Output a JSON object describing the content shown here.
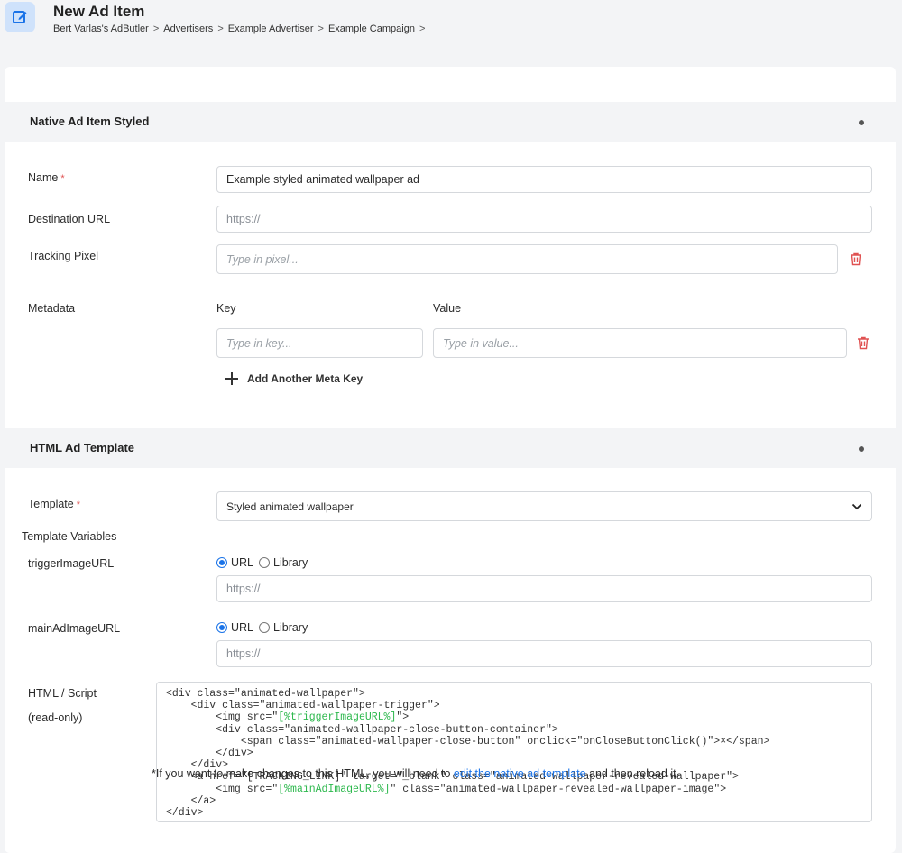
{
  "header": {
    "title": "New Ad Item",
    "breadcrumb": [
      "Bert Varlas's AdButler",
      "Advertisers",
      "Example Advertiser",
      "Example Campaign"
    ],
    "breadcrumb_sep": ">"
  },
  "native_section": {
    "title": "Native Ad Item Styled",
    "name_label": "Name",
    "required_mark": "*",
    "name_value": "Example styled animated wallpaper ad",
    "dest_label": "Destination URL",
    "dest_placeholder": "https://",
    "tracking_label": "Tracking Pixel",
    "tracking_placeholder": "Type in pixel...",
    "metadata_label": "Metadata",
    "key_header": "Key",
    "value_header": "Value",
    "key_placeholder": "Type in key...",
    "value_placeholder": "Type in value...",
    "add_meta_label": "Add Another Meta Key"
  },
  "html_section": {
    "title": "HTML Ad Template",
    "template_label": "Template",
    "template_value": "Styled animated wallpaper",
    "template_vars_label": "Template Variables",
    "var1_label": "triggerImageURL",
    "var2_label": "mainAdImageURL",
    "radio_url": "URL",
    "radio_library": "Library",
    "url_placeholder": "https://",
    "script_label": "HTML / Script",
    "readonly_label": "(read-only)",
    "code_lines": [
      {
        "text": "<div class=\"animated-wallpaper\">"
      },
      {
        "text": "    <div class=\"animated-wallpaper-trigger\">"
      },
      {
        "text": "        <img src=\"",
        "var": "[%triggerImageURL%]",
        "after": "\">"
      },
      {
        "text": "        <div class=\"animated-wallpaper-close-button-container\">"
      },
      {
        "text": "            <span class=\"animated-wallpaper-close-button\" onclick=\"onCloseButtonClick()\">×</span>"
      },
      {
        "text": "        </div>"
      },
      {
        "text": "    </div>"
      },
      {
        "text": "    <a href=\"[TRACKING_LINK]\" target=\"_blank\" class=\"animated-wallpaper-revealed-wallpaper\">"
      },
      {
        "text": "        <img src=\"",
        "var": "[%mainAdImageURL%]",
        "after": "\" class=\"animated-wallpaper-revealed-wallpaper-image\">"
      },
      {
        "text": "    </a>"
      },
      {
        "text": "</div>"
      }
    ],
    "note_before": "*If you want to make changes to this HTML, you will need to ",
    "note_link": "edit the native ad template",
    "note_after": " and then reload it."
  },
  "colors": {
    "accent": "#1a73e8",
    "danger": "#e05252",
    "code_var": "#2db84d"
  }
}
